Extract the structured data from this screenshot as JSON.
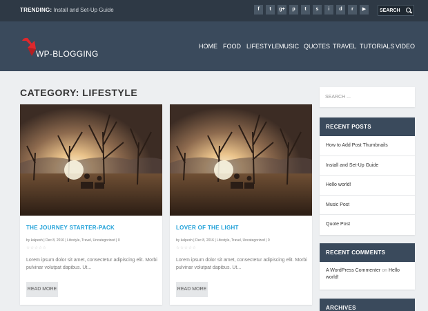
{
  "topbar": {
    "trending_label": "TRENDING:",
    "trending_text": "Install and Set-Up Guide",
    "social_icons": [
      "facebook-icon",
      "twitter-icon",
      "google-plus-icon",
      "pinterest-icon",
      "tumblr-icon",
      "stumbleupon-icon",
      "instagram-icon",
      "dribbble-icon",
      "rss-icon",
      "youtube-icon"
    ],
    "social_glyphs": [
      "f",
      "t",
      "g+",
      "p",
      "t",
      "s",
      "i",
      "d",
      "r",
      "▶"
    ],
    "search_placeholder": "SEARCH"
  },
  "header": {
    "logo_text": "WP-BLOGGING",
    "nav": [
      "HOME",
      "FOOD",
      "LIFESTYLE",
      "MUSIC",
      "QUOTES",
      "TRAVEL",
      "TUTORIALS",
      "VIDEO"
    ]
  },
  "main": {
    "category_title": "CATEGORY: LIFESTYLE",
    "posts": [
      {
        "title": "THE JOURNEY STARTER-PACK",
        "meta": "by kalpesh | Dec 8, 2016 | Lifestyle, Travel, Uncategorized | 0",
        "stars": "☆☆☆☆☆",
        "excerpt": "Lorem ipsum dolor sit amet, consectetur adipiscing elit. Morbi pulvinar volutpat dapibus. Ut...",
        "read_more": "READ MORE"
      },
      {
        "title": "LOVER OF THE LIGHT",
        "meta": "by kalpesh | Dec 8, 2016 | Lifestyle, Travel, Uncategorized | 0",
        "stars": "☆☆☆☆☆",
        "excerpt": "Lorem ipsum dolor sit amet, consectetur adipiscing elit. Morbi pulvinar volutpat dapibus. Ut...",
        "read_more": "READ MORE"
      }
    ]
  },
  "sidebar": {
    "search_placeholder": "SEARCH ...",
    "recent_posts_title": "RECENT POSTS",
    "recent_posts": [
      "How to Add Post Thumbnails",
      "Install and Set-Up Guide",
      "Hello world!",
      "Music Post",
      "Quote Post"
    ],
    "recent_comments_title": "RECENT COMMENTS",
    "comment_author": "A WordPress Commenter",
    "comment_on": "on",
    "comment_post": "Hello world!",
    "archives_title": "ARCHIVES"
  },
  "colors": {
    "topbar": "#2e3945",
    "header": "#3a4a5c",
    "accent_blue": "#1ea0d8",
    "logo_red": "#e0282c",
    "page_bg": "#edeff1"
  }
}
